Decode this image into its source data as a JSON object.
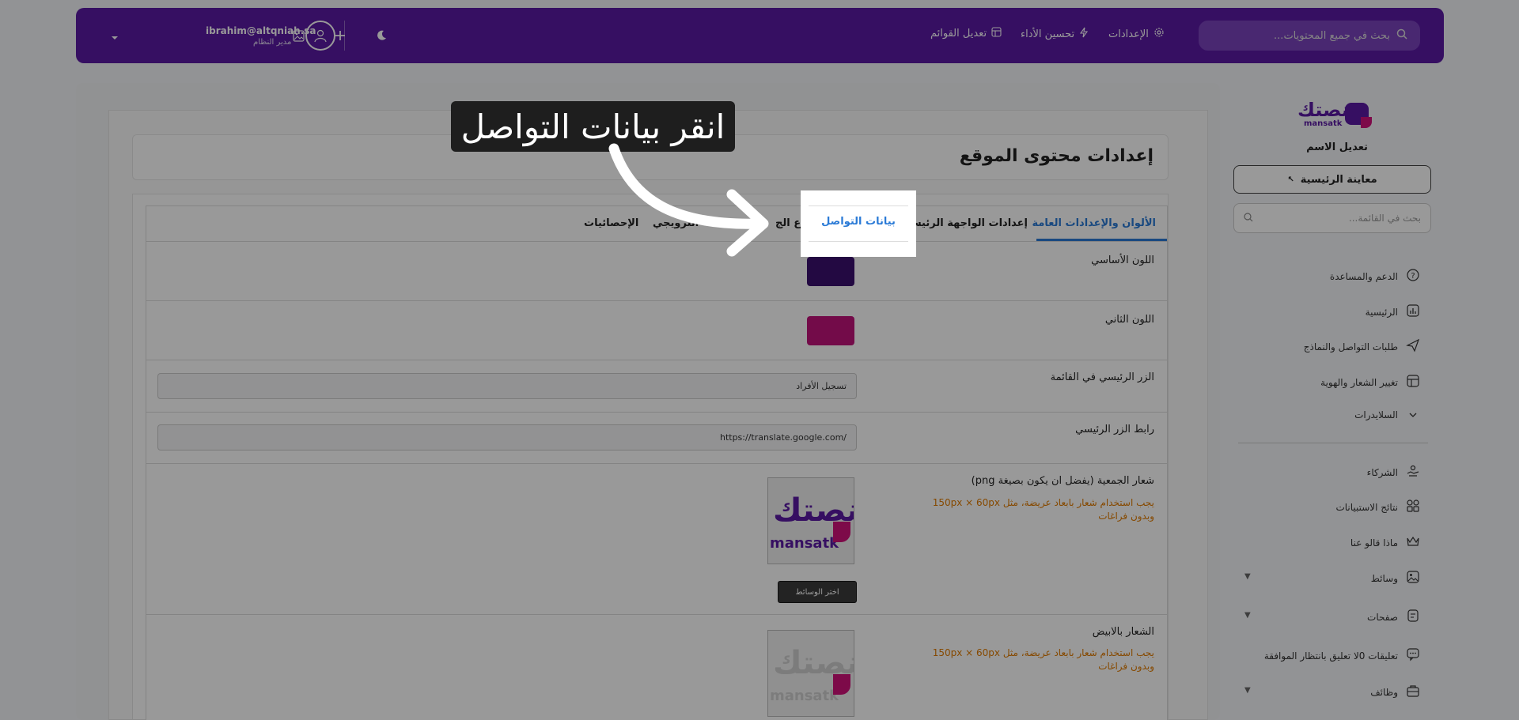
{
  "header": {
    "search_placeholder": "بحث في جميع المحتويات...",
    "nav": {
      "settings": "الإعدادات",
      "performance": "تحسين الأداء",
      "edit_menus": "تعديل القوائم"
    },
    "user": {
      "email": "ibrahim@altqniah.sa",
      "role": "مدير النظام"
    }
  },
  "sidebar": {
    "logo_text": "منصتك",
    "logo_sub": "mansatk",
    "edit_name": "تعديل الاسم",
    "preview_label": "معاينة الرئيسية",
    "search_placeholder": "بحث في القائمة...",
    "items": [
      {
        "label": "الدعم والمساعدة",
        "icon": "help-circle-icon"
      },
      {
        "label": "الرئيسية",
        "icon": "chart-icon"
      },
      {
        "label": "طلبات التواصل والنماذج",
        "icon": "send-icon"
      },
      {
        "label": "تغيير الشعار والهوية",
        "icon": "layout-icon"
      },
      {
        "label": "السلايدرات",
        "icon": "chevron-down-icon"
      },
      {
        "label": "الشركاء",
        "icon": "handshake-icon"
      },
      {
        "label": "نتائج الاستبيانات",
        "icon": "grid-icon"
      },
      {
        "label": "ماذا قالو عنا",
        "icon": "crown-icon"
      },
      {
        "label": "وسائط",
        "icon": "image-icon"
      },
      {
        "label": "صفحات",
        "icon": "pages-icon"
      },
      {
        "label": "تعليقات 0لا تعليق بانتظار الموافقة",
        "icon": "comment-icon"
      },
      {
        "label": "وظائف",
        "icon": "briefcase-icon"
      }
    ]
  },
  "main": {
    "page_title": "إعدادات محتوى الموقع",
    "tabs": [
      {
        "label": "الألوان والإعدادات العامة",
        "active": true
      },
      {
        "label": "إعدادات الواجهة الرئيسية",
        "active": false
      },
      {
        "label": "روع الج",
        "active": false
      },
      {
        "label": "الترويجي",
        "active": false
      },
      {
        "label": "الإحصائيات",
        "active": false
      }
    ],
    "rows": {
      "primary_color_label": "اللون الأساسي",
      "primary_color": "#3b0f6e",
      "secondary_color_label": "اللون الثاني",
      "secondary_color": "#c0137a",
      "main_button_label": "الزر الرئيسي في القائمة",
      "main_button_value": "تسجيل الأفراد",
      "main_button_link_label": "رابط الزر الرئيسي",
      "main_button_link_value": "https://translate.google.com/",
      "org_logo_label": "شعار الجمعية (يفضل ان يكون بصيغة png)",
      "org_logo_hint": "يجب استخدام شعار بابعاد عريضة، مثل 150px × 60px وبدون فراغات",
      "choose_media": "اختر الوسائط",
      "white_logo_label": "الشعار بالابيض",
      "white_logo_hint": "يجب استخدام شعار بابعاد عريضة، مثل 150px × 60px وبدون فراغات"
    }
  },
  "tutorial": {
    "instruction": "انقر بيانات التواصل",
    "highlight_label": "بيانات التواصل"
  },
  "colors": {
    "header_bg": "#5a1aa3",
    "accent": "#2a7ad6",
    "hint": "#e07b00"
  }
}
